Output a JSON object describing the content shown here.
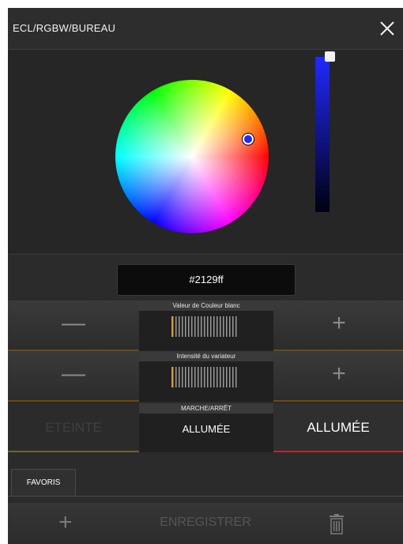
{
  "header": {
    "title": "ECL/RGBW/BUREAU",
    "close_icon": "close-icon"
  },
  "picker": {
    "selected_color": "#2129ff",
    "brightness": 1.0
  },
  "hex": {
    "value": "#2129ff"
  },
  "white_value": {
    "label": "Valeur de Couleur blanc",
    "minus": "—",
    "plus": "+",
    "level": 0
  },
  "dimmer": {
    "label": "Intensité du variateur",
    "minus": "—",
    "plus": "+",
    "level": 0
  },
  "power": {
    "label": "MARCHE/ARRÊT",
    "off_label": "ETEINTE",
    "state": "ALLUMÉE",
    "on_label": "ALLUMÉE"
  },
  "favorites": {
    "tab_label": "FAVORIS"
  },
  "footer": {
    "add": "+",
    "save_label": "ENREGISTRER",
    "trash_icon": "trash-icon"
  }
}
